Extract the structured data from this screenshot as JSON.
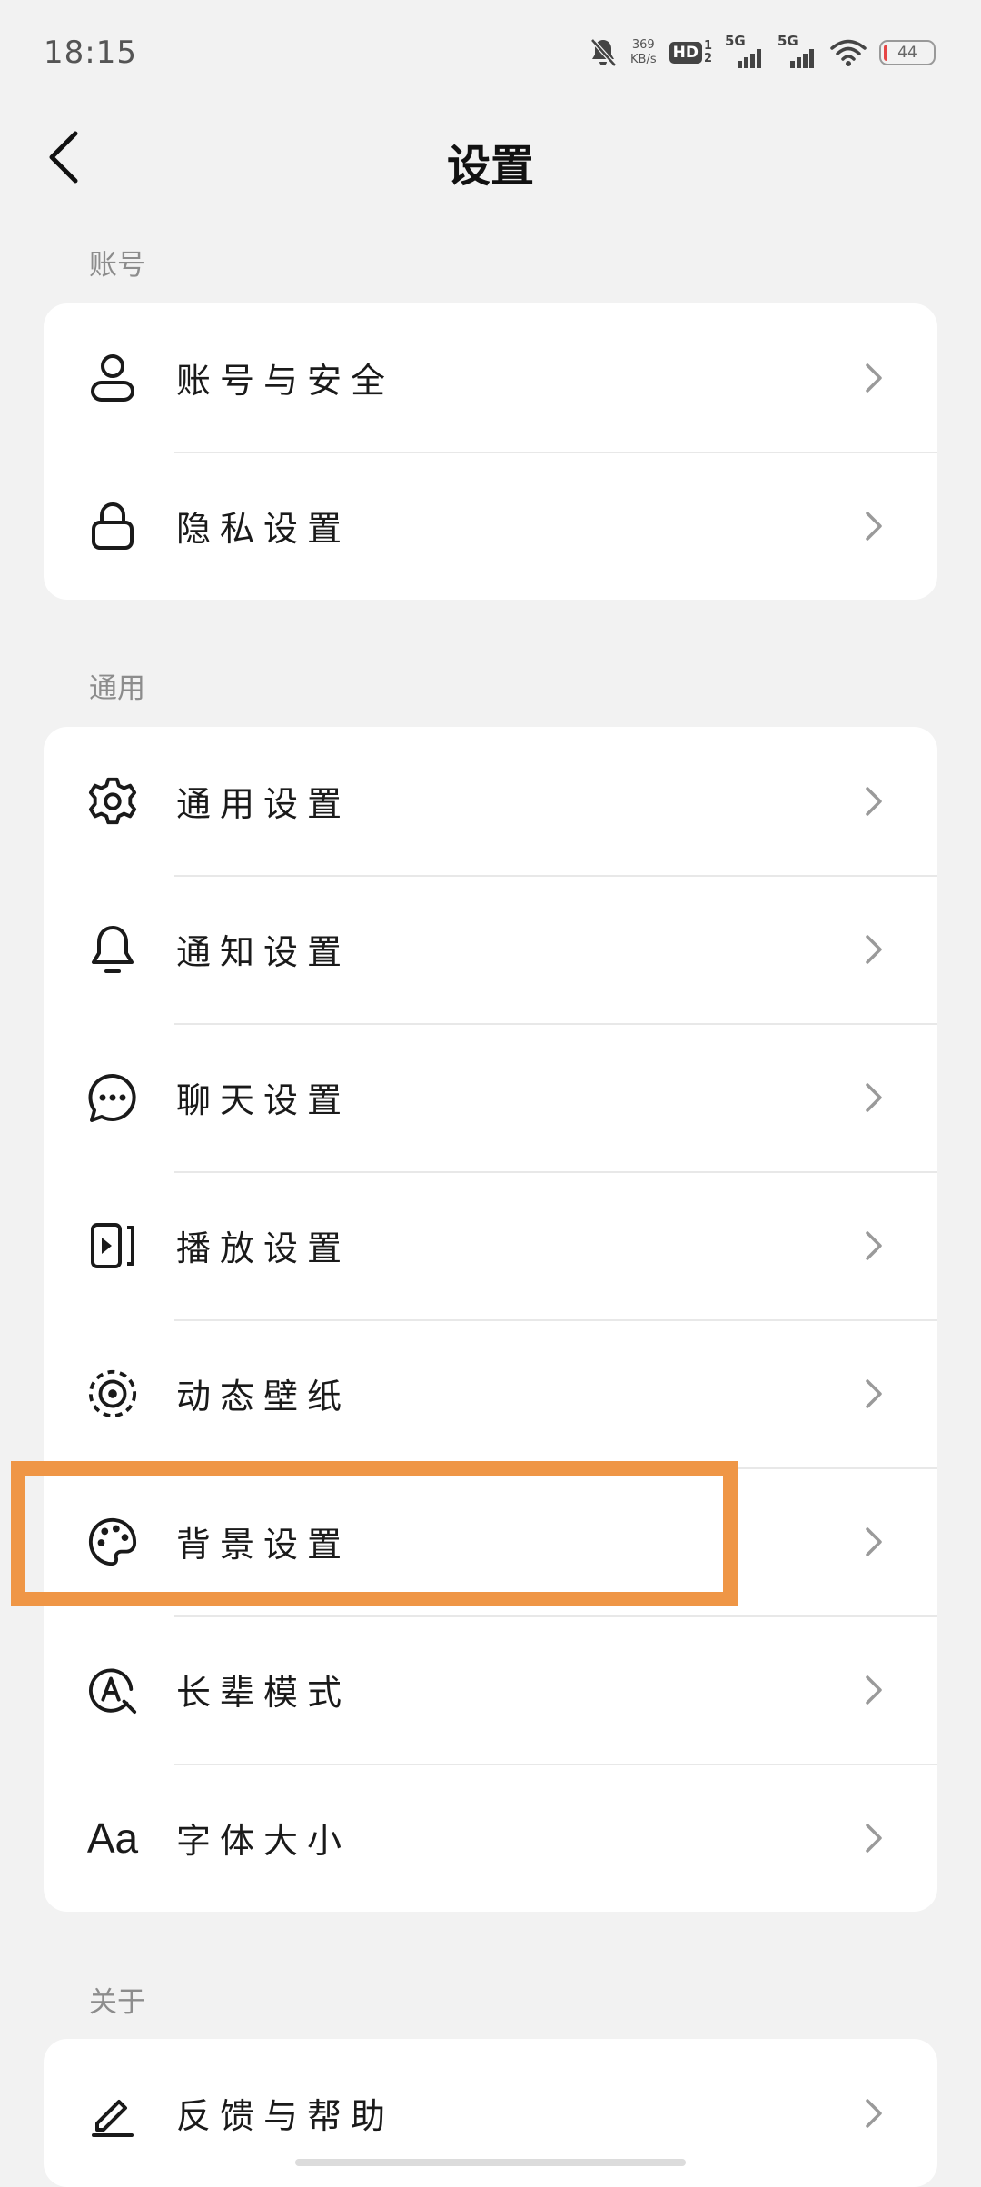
{
  "status_bar": {
    "time": "18:15",
    "net_speed_value": "369",
    "net_speed_unit": "KB/s",
    "hd_label": "HD",
    "hd_sim_top": "1",
    "hd_sim_bottom": "2",
    "signal1_label": "5G",
    "signal2_label": "5G",
    "battery": "44"
  },
  "header": {
    "title": "设置"
  },
  "sections": {
    "account": {
      "label": "账号",
      "items": [
        {
          "label": "账号与安全",
          "icon": "person-icon"
        },
        {
          "label": "隐私设置",
          "icon": "lock-icon"
        }
      ]
    },
    "general": {
      "label": "通用",
      "items": [
        {
          "label": "通用设置",
          "icon": "gear-icon"
        },
        {
          "label": "通知设置",
          "icon": "bell-icon"
        },
        {
          "label": "聊天设置",
          "icon": "chat-bubble-icon"
        },
        {
          "label": "播放设置",
          "icon": "play-icon"
        },
        {
          "label": "动态壁纸",
          "icon": "live-wallpaper-icon"
        },
        {
          "label": "背景设置",
          "icon": "palette-icon"
        },
        {
          "label": "长辈模式",
          "icon": "elder-mode-icon"
        },
        {
          "label": "字体大小",
          "icon": "font-size-icon",
          "glyph": "Aa"
        }
      ]
    },
    "about": {
      "label": "关于",
      "items": [
        {
          "label": "反馈与帮助",
          "icon": "pencil-icon"
        }
      ]
    }
  },
  "colors": {
    "background": "#f2f2f2",
    "card": "#ffffff",
    "highlight": "#ef9646",
    "chevron": "#9a9a9a"
  }
}
